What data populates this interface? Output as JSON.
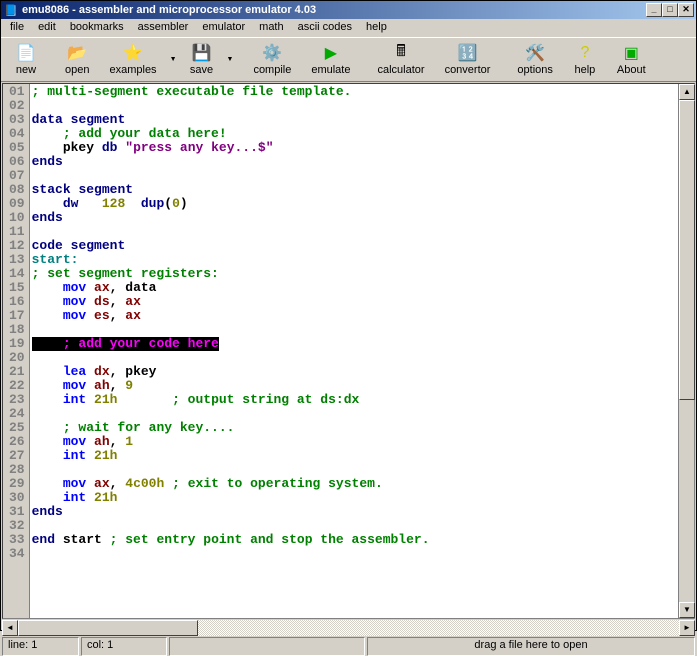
{
  "window": {
    "title": "emu8086 - assembler and microprocessor emulator 4.03"
  },
  "menu": {
    "items": [
      "file",
      "edit",
      "bookmarks",
      "assembler",
      "emulator",
      "math",
      "ascii codes",
      "help"
    ]
  },
  "toolbar": {
    "items": [
      "new",
      "open",
      "examples",
      "save",
      "compile",
      "emulate",
      "calculator",
      "convertor",
      "options",
      "help",
      "About"
    ]
  },
  "status": {
    "line": "line: 1",
    "col": "col: 1",
    "hint": "drag a file here to open"
  },
  "gutter": [
    "01",
    "02",
    "03",
    "04",
    "05",
    "06",
    "07",
    "08",
    "09",
    "10",
    "11",
    "12",
    "13",
    "14",
    "15",
    "16",
    "17",
    "18",
    "19",
    "20",
    "21",
    "22",
    "23",
    "24",
    "25",
    "26",
    "27",
    "28",
    "29",
    "30",
    "31",
    "32",
    "33",
    "34"
  ],
  "code": {
    "l1": {
      "comment": "; multi-segment executable file template."
    },
    "l3": {
      "a": "data",
      "b": "segment"
    },
    "l4": {
      "comment": "; add your data here!"
    },
    "l5": {
      "a": "pkey",
      "b": "db",
      "s": "\"press any key...$\""
    },
    "l6": {
      "kw": "ends"
    },
    "l8": {
      "a": "stack",
      "b": "segment"
    },
    "l9": {
      "a": "dw",
      "n": "128",
      "b": "dup",
      "c": "(",
      "z": "0",
      "d": ")"
    },
    "l10": {
      "kw": "ends"
    },
    "l12": {
      "a": "code",
      "b": "segment"
    },
    "l13": {
      "label": "start:"
    },
    "l14": {
      "comment": "; set segment registers:"
    },
    "l15": {
      "i": "mov",
      "r": "ax",
      "c": ",",
      "v": "data"
    },
    "l16": {
      "i": "mov",
      "r": "ds",
      "c": ",",
      "r2": "ax"
    },
    "l17": {
      "i": "mov",
      "r": "es",
      "c": ",",
      "r2": "ax"
    },
    "l19": {
      "pad": "    ",
      "comment": "; add your code here"
    },
    "l21": {
      "i": "lea",
      "r": "dx",
      "c": ",",
      "v": "pkey"
    },
    "l22": {
      "i": "mov",
      "r": "ah",
      "c": ",",
      "n": "9"
    },
    "l23": {
      "i": "int",
      "n": "21h",
      "comment": "; output string at ds:dx"
    },
    "l25": {
      "comment": "; wait for any key...."
    },
    "l26": {
      "i": "mov",
      "r": "ah",
      "c": ",",
      "n": "1"
    },
    "l27": {
      "i": "int",
      "n": "21h"
    },
    "l29": {
      "i": "mov",
      "r": "ax",
      "c": ",",
      "n": "4c00h",
      "comment": "; exit to operating system."
    },
    "l30": {
      "i": "int",
      "n": "21h"
    },
    "l31": {
      "kw": "ends"
    },
    "l33": {
      "a": "end",
      "b": "start",
      "comment": "; set entry point and stop the assembler."
    }
  }
}
